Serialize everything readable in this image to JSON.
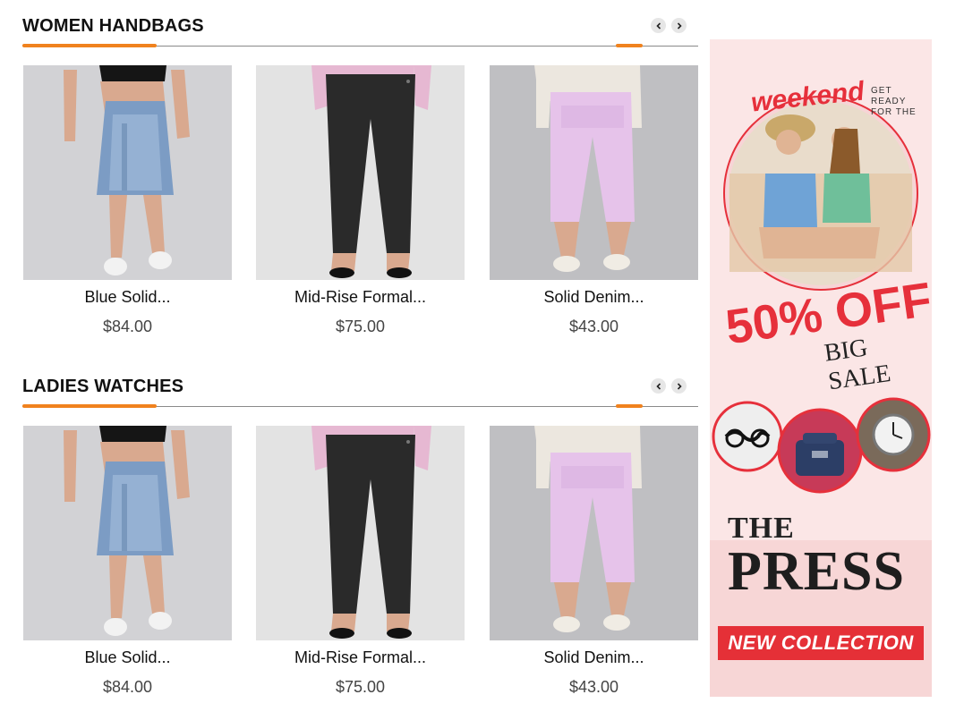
{
  "sections": [
    {
      "title": "WOMEN HANDBAGS",
      "products": [
        {
          "name": "Blue Solid...",
          "price": "$84.00"
        },
        {
          "name": "Mid-Rise Formal...",
          "price": "$75.00"
        },
        {
          "name": "Solid Denim...",
          "price": "$43.00"
        }
      ]
    },
    {
      "title": "LADIES WATCHES",
      "products": [
        {
          "name": "Blue Solid...",
          "price": "$84.00"
        },
        {
          "name": "Mid-Rise Formal...",
          "price": "$75.00"
        },
        {
          "name": "Solid Denim...",
          "price": "$43.00"
        }
      ]
    }
  ],
  "banner": {
    "weekend": "weekend",
    "get_ready": "GET READY FOR THE",
    "discount": "50% OFF",
    "big_sale": "BIG SALE",
    "the": "THE",
    "press": "PRESS",
    "cta": "NEW COLLECTION"
  },
  "colors": {
    "accent": "#f0821e",
    "sale_red": "#e6303b",
    "banner_bg": "#fbe6e6"
  },
  "icons": {
    "prev": "chevron-left-icon",
    "next": "chevron-right-icon"
  }
}
